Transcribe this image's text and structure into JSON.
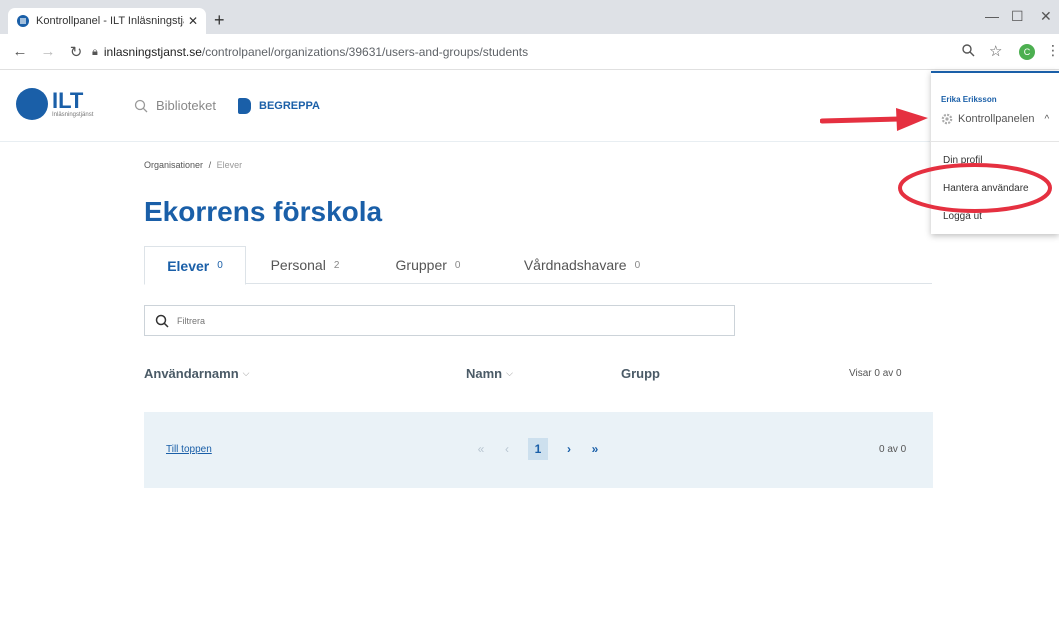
{
  "browser": {
    "tab_title": "Kontrollpanel - ILT Inläsningstjän",
    "url_host": "inlasningstjanst.se",
    "url_path": "/controlpanel/organizations/39631/users-and-groups/students",
    "profile_initial": "C"
  },
  "header": {
    "logo_text": "ILT",
    "logo_sub": "Inläsningstjänst",
    "nav_library": "Biblioteket",
    "nav_begreppa": "BEGREPPA"
  },
  "breadcrumb": {
    "root": "Organisationer",
    "separator": "/",
    "current": "Elever"
  },
  "page_title": "Ekorrens förskola",
  "tabs": [
    {
      "label": "Elever",
      "count": "0"
    },
    {
      "label": "Personal",
      "count": "2"
    },
    {
      "label": "Grupper",
      "count": "0"
    },
    {
      "label": "Vårdnadshavare",
      "count": "0"
    }
  ],
  "filter": {
    "placeholder": "Filtrera"
  },
  "table": {
    "col_username": "Användarnamn",
    "col_name": "Namn",
    "col_group": "Grupp",
    "showing": "Visar 0 av 0"
  },
  "pager": {
    "to_top": "Till toppen",
    "current_page": "1",
    "count": "0 av 0"
  },
  "dropdown": {
    "user_name": "Erika Eriksson",
    "control_panel": "Kontrollpanelen",
    "items": [
      "Din profil",
      "Hantera användare",
      "Logga ut"
    ]
  },
  "colors": {
    "brand": "#1a5fa8",
    "annotation": "#e53040",
    "pager_bg": "#eaf2f7"
  }
}
